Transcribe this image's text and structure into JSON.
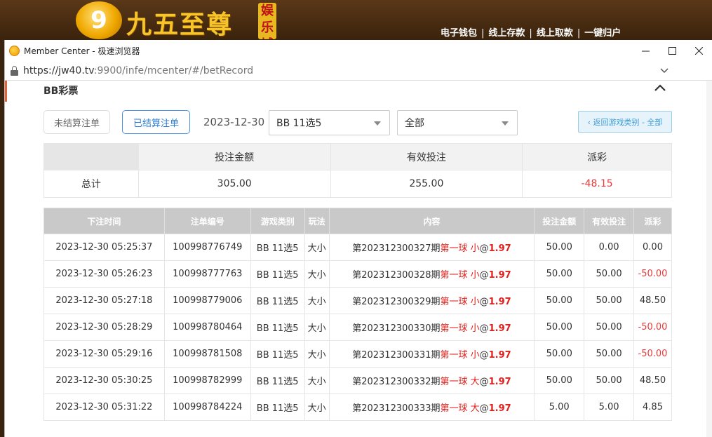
{
  "site": {
    "logo_digit": "9",
    "logo_text": "九五至尊",
    "logo_tag": "娱乐城",
    "nav": [
      "电子钱包",
      "线上存款",
      "线上取款",
      "一键归户"
    ]
  },
  "window": {
    "title": "Member Center - 极速浏览器",
    "url_host": "https://jw40.tv",
    "url_rest": ":9900/infe/mcenter/#/betRecord"
  },
  "section": {
    "title": "BB彩票"
  },
  "filters": {
    "unsettled_label": "未结算注单",
    "settled_label": "已结算注单",
    "date": "2023-12-30",
    "game_select": "BB 11选5",
    "type_select": "全部",
    "back_label": "‹ 返回游戏类别 - 全部"
  },
  "summary": {
    "headers": [
      "投注金额",
      "有效投注",
      "派彩"
    ],
    "row_label": "总计",
    "bet_amount": "305.00",
    "valid_bet": "255.00",
    "payout": "-48.15"
  },
  "records": {
    "headers": [
      "下注时间",
      "注单编号",
      "游戏类别",
      "玩法",
      "内容",
      "投注金额",
      "有效投注",
      "派彩"
    ],
    "rows": [
      {
        "time": "2023-12-30 05:25:37",
        "id": "100998776749",
        "game": "BB 11选5",
        "play": "大小",
        "period": "第202312300327期",
        "pick": "第一球 小",
        "odds": "1.97",
        "bet": "50.00",
        "valid": "0.00",
        "payout": "0.00"
      },
      {
        "time": "2023-12-30 05:26:23",
        "id": "100998777763",
        "game": "BB 11选5",
        "play": "大小",
        "period": "第202312300328期",
        "pick": "第一球 小",
        "odds": "1.97",
        "bet": "50.00",
        "valid": "50.00",
        "payout": "-50.00"
      },
      {
        "time": "2023-12-30 05:27:18",
        "id": "100998779006",
        "game": "BB 11选5",
        "play": "大小",
        "period": "第202312300329期",
        "pick": "第一球 小",
        "odds": "1.97",
        "bet": "50.00",
        "valid": "50.00",
        "payout": "48.50"
      },
      {
        "time": "2023-12-30 05:28:29",
        "id": "100998780464",
        "game": "BB 11选5",
        "play": "大小",
        "period": "第202312300330期",
        "pick": "第一球 小",
        "odds": "1.97",
        "bet": "50.00",
        "valid": "50.00",
        "payout": "-50.00"
      },
      {
        "time": "2023-12-30 05:29:16",
        "id": "100998781508",
        "game": "BB 11选5",
        "play": "大小",
        "period": "第202312300331期",
        "pick": "第一球 小",
        "odds": "1.97",
        "bet": "50.00",
        "valid": "50.00",
        "payout": "-50.00"
      },
      {
        "time": "2023-12-30 05:30:25",
        "id": "100998782999",
        "game": "BB 11选5",
        "play": "大小",
        "period": "第202312300332期",
        "pick": "第一球 大",
        "odds": "1.97",
        "bet": "50.00",
        "valid": "50.00",
        "payout": "48.50"
      },
      {
        "time": "2023-12-30 05:31:22",
        "id": "100998784224",
        "game": "BB 11选5",
        "play": "大小",
        "period": "第202312300333期",
        "pick": "第一球 大",
        "odds": "1.97",
        "bet": "5.00",
        "valid": "5.00",
        "payout": "4.85"
      }
    ]
  },
  "colors": {
    "negative": "#e63b3b",
    "accent_blue": "#4a90e2",
    "brand_gold": "#f7c429"
  }
}
